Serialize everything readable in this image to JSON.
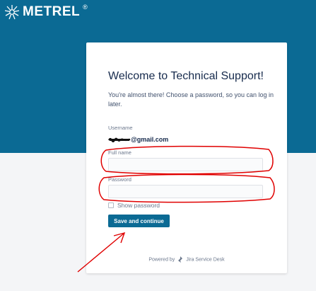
{
  "brand": {
    "name": "METREL",
    "registered_mark": "®",
    "color": "#0b6a94"
  },
  "card": {
    "title": "Welcome to Technical Support!",
    "intro": "You're almost there! Choose a password, so you can log in later.",
    "username_label": "Username",
    "username_value": "@gmail.com",
    "fullname_label": "Full name",
    "fullname_value": "",
    "password_label": "Password",
    "password_value": "",
    "show_password_label": "Show password",
    "save_button": "Save and continue",
    "powered_by": "Powered by",
    "powered_product": "Jira Service Desk"
  },
  "annotation_color": "#e00000"
}
